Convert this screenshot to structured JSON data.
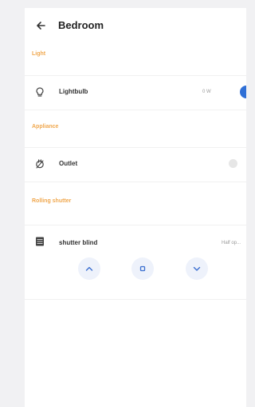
{
  "header": {
    "title": "Bedroom",
    "back_icon": "back-arrow-icon"
  },
  "sections": {
    "light": "Light",
    "appliance": "Appliance",
    "shutter": "Rolling shutter"
  },
  "devices": {
    "lightbulb": {
      "label": "Lightbulb",
      "value": "0 W",
      "icon": "lightbulb-icon",
      "on": true
    },
    "outlet": {
      "label": "Outlet",
      "icon": "outlet-icon",
      "on": false
    },
    "shutter": {
      "label": "shutter blind",
      "status": "Half op...",
      "icon": "shutter-icon",
      "controls": [
        "up",
        "stop",
        "down"
      ]
    }
  },
  "colors": {
    "accent_orange": "#f0a84f",
    "accent_blue": "#2f6fd6",
    "control_bg": "#eef2fb"
  }
}
